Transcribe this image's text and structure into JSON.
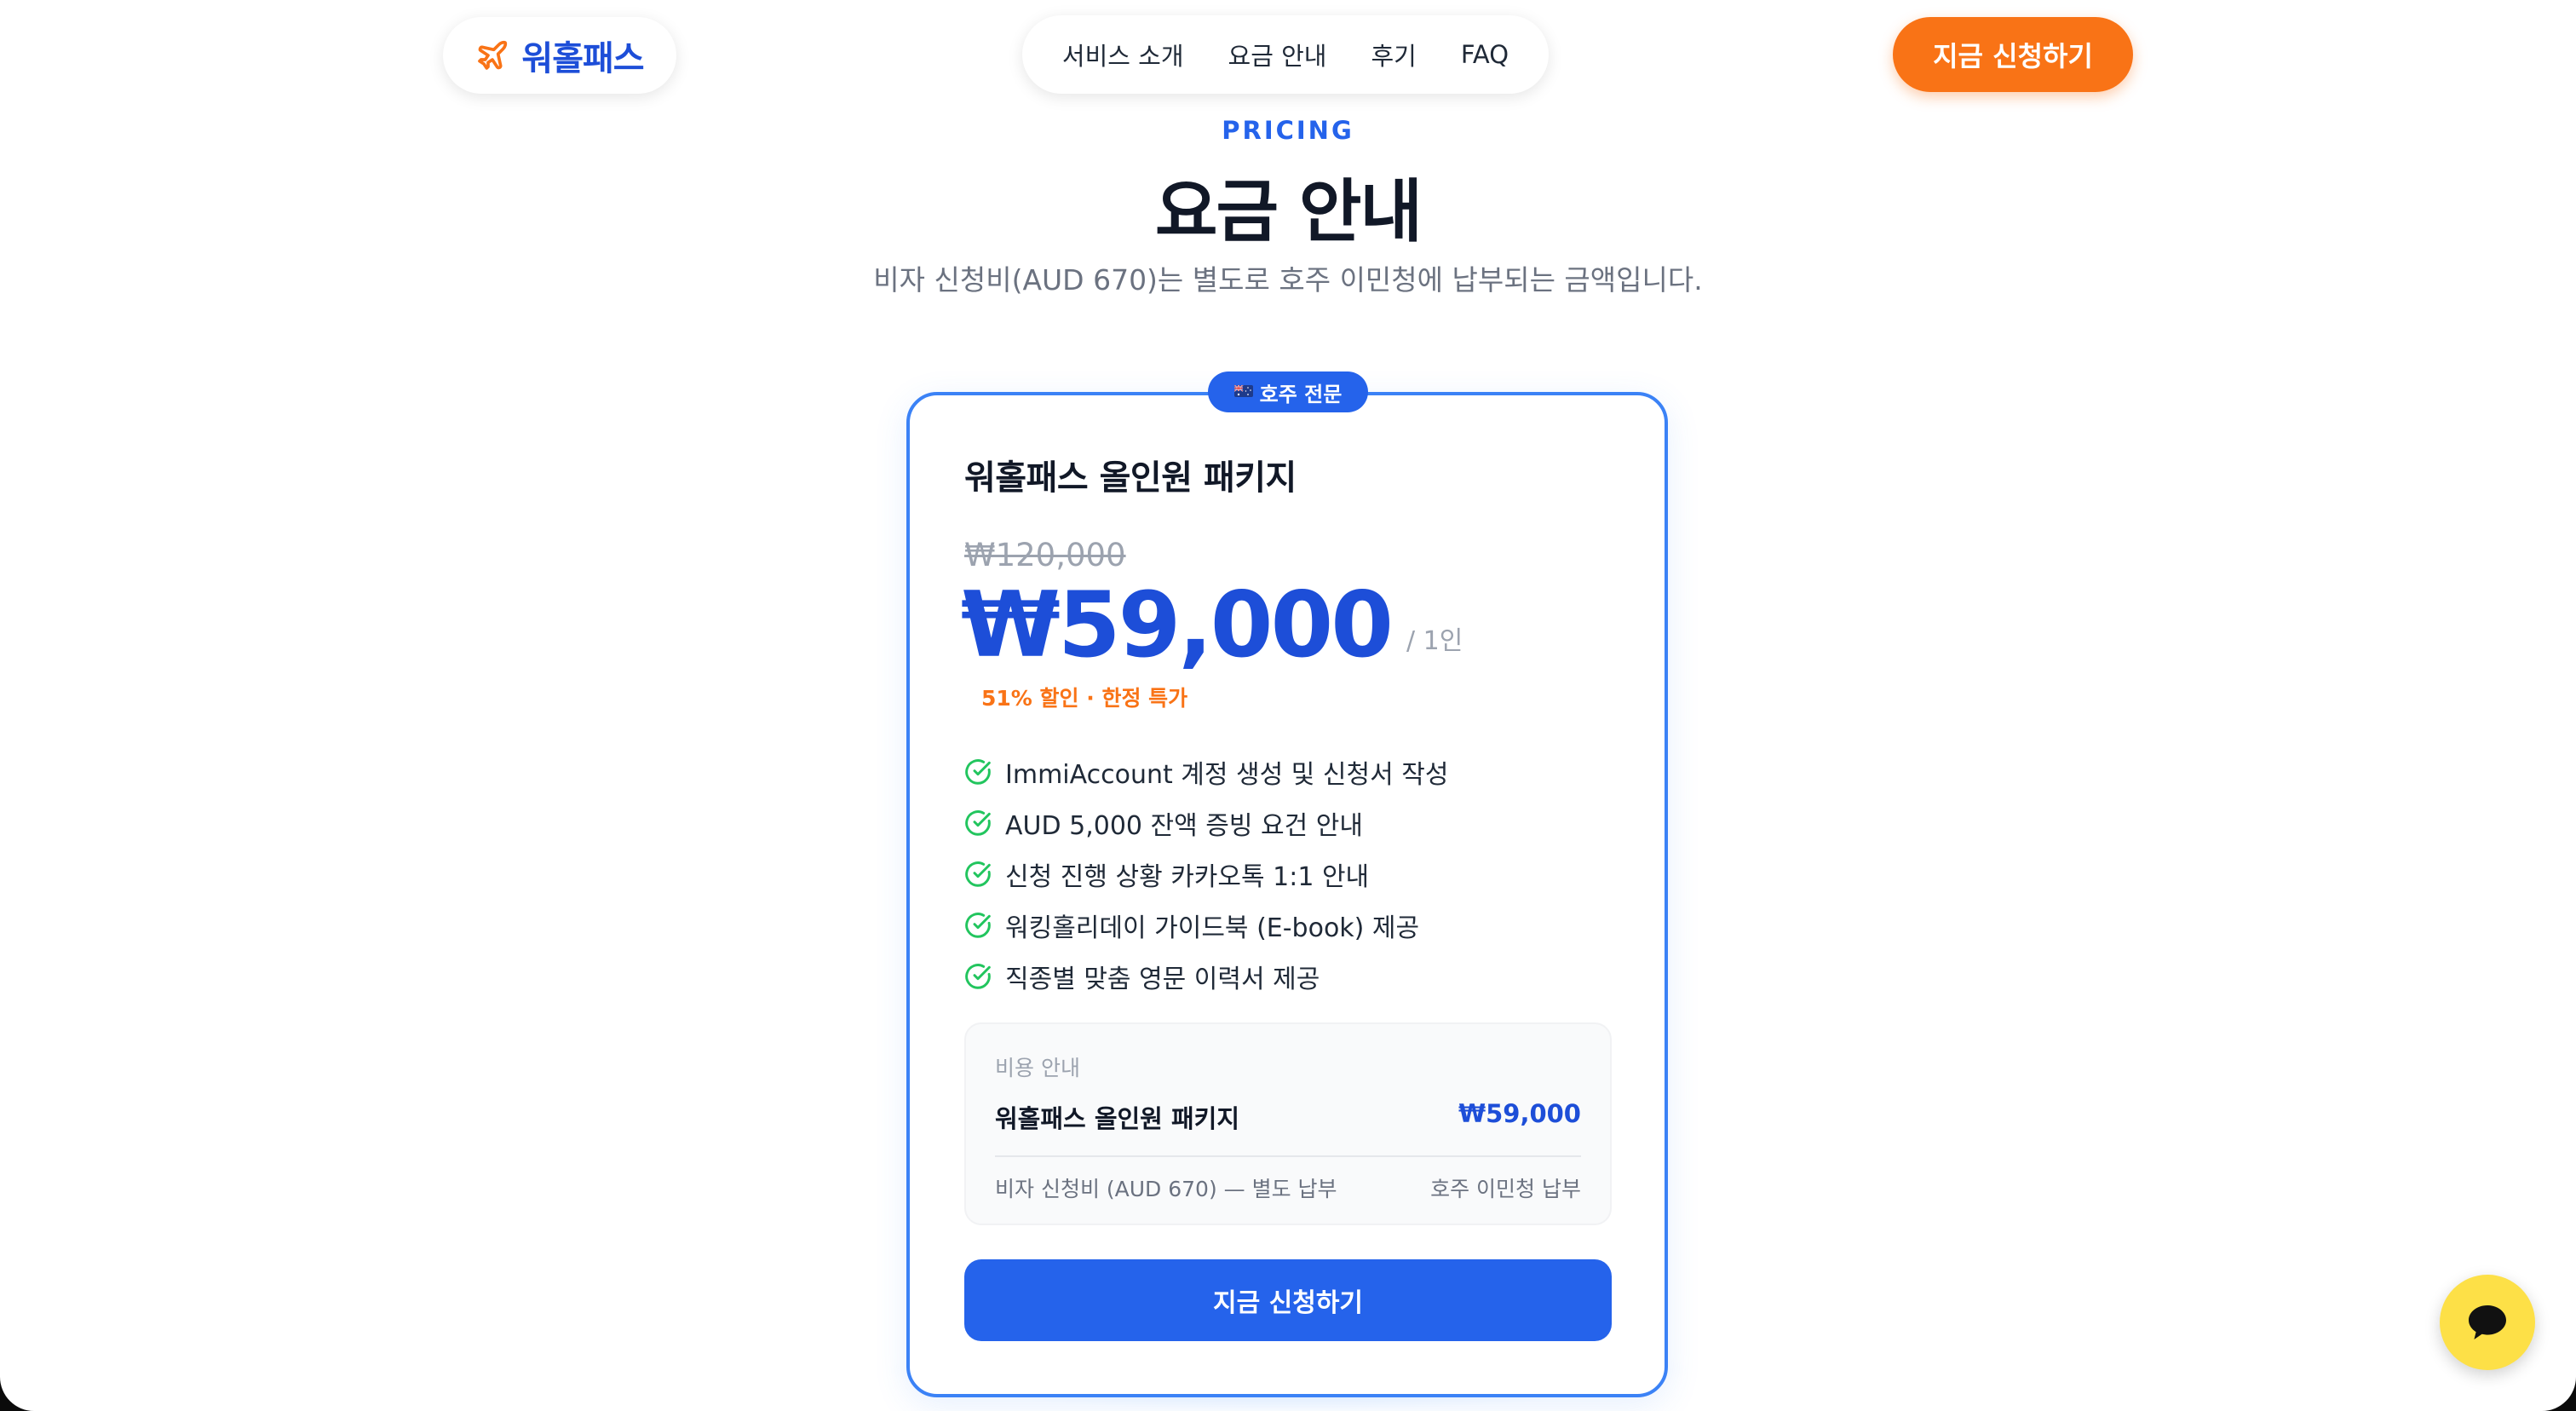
{
  "header": {
    "logo_text": "워홀패스",
    "nav": [
      "서비스 소개",
      "요금 안내",
      "후기",
      "FAQ"
    ],
    "cta": "지금 신청하기",
    "brand_color": "#1d4ed8",
    "accent_color": "#f97316"
  },
  "pricing": {
    "eyebrow": "PRICING",
    "title": "요금 안내",
    "subtitle": "비자 신청비(AUD 670)는 별도로 호주 이민청에 납부되는 금액입니다.",
    "badge": "호주 전문",
    "badge_icon": "australia-flag-icon",
    "package_name": "워홀패스 올인원 패키지",
    "original_price": "₩120,000",
    "price": "₩59,000",
    "per": "/ 1인",
    "discount": "51% 할인 · 한정 특가",
    "features": [
      "ImmiAccount 계정 생성 및 신청서 작성",
      "AUD 5,000 잔액 증빙 요건 안내",
      "신청 진행 상황 카카오톡 1:1 안내",
      "워킹홀리데이 가이드북 (E-book) 제공",
      "직종별 맞춤 영문 이력서 제공"
    ],
    "cost": {
      "label": "비용 안내",
      "item_name": "워홀패스 올인원 패키지",
      "item_price": "₩59,000",
      "fee_text": "비자 신청비 (AUD 670) — 별도 납부",
      "fee_payee": "호주 이민청 납부"
    },
    "cta": "지금 신청하기",
    "primary_color": "#2563eb"
  },
  "chat": {
    "icon": "chat-bubble-icon",
    "color": "#fde047"
  }
}
